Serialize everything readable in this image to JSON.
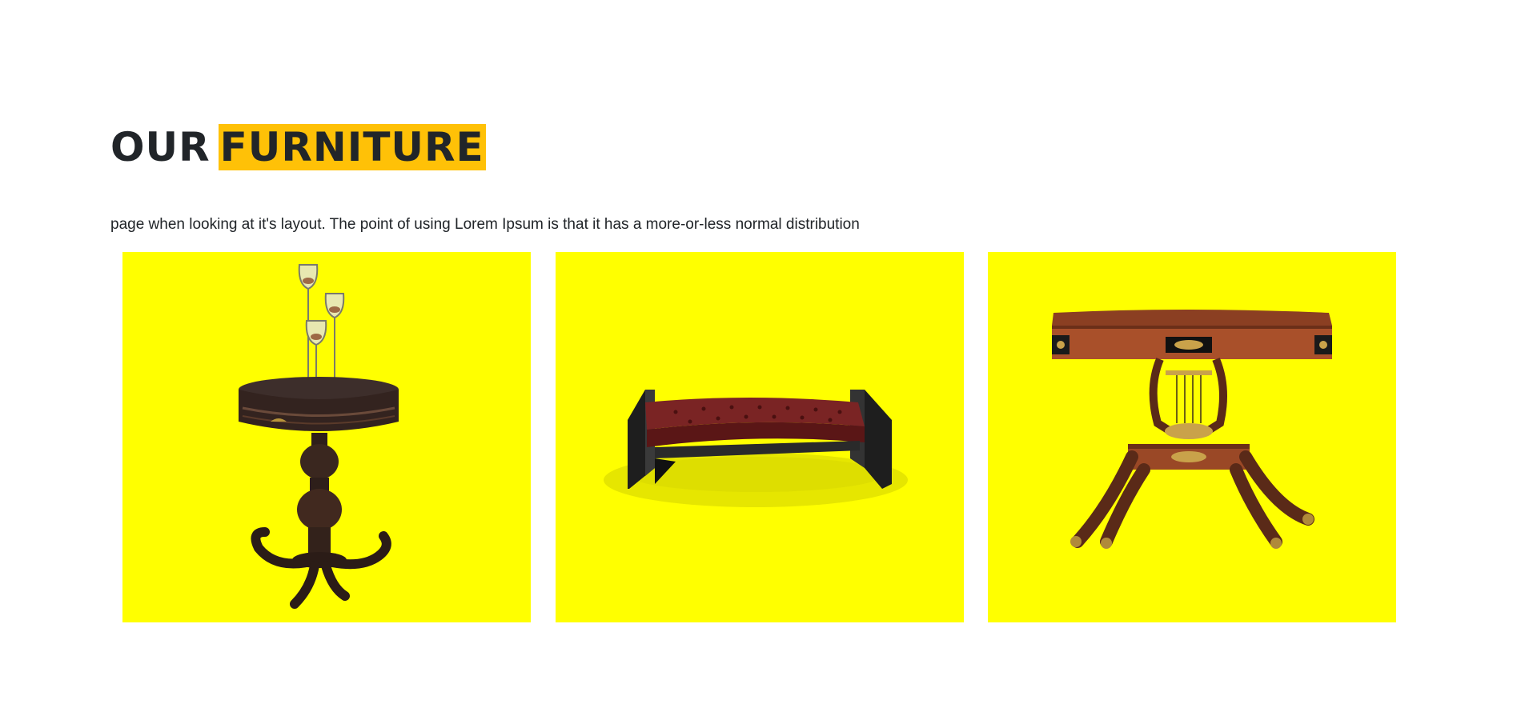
{
  "section": {
    "title_plain": "OUR",
    "title_highlight": "FURNITURE",
    "description": "page when looking at it's layout. The point of using Lorem Ipsum is that it has a more-or-less normal distribution"
  },
  "colors": {
    "highlight": "#ffc107",
    "card_background": "#ffff00",
    "text": "#212529"
  },
  "gallery": {
    "items": [
      {
        "name": "round-pedestal-table-with-wine-glasses",
        "icon": "pedestal-table-image"
      },
      {
        "name": "tufted-leather-bench",
        "icon": "bench-image"
      },
      {
        "name": "lyre-base-console-table",
        "icon": "console-table-image"
      }
    ]
  }
}
